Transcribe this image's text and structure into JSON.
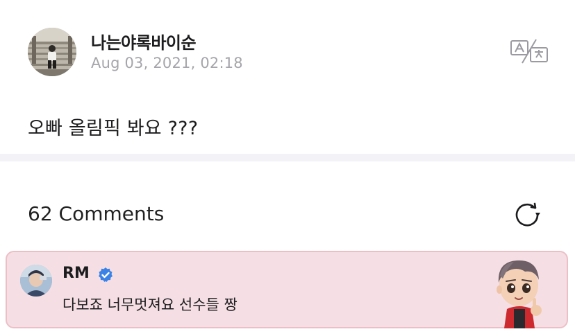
{
  "post": {
    "author": "나는야록바이순",
    "date": "Aug 03, 2021, 02:18",
    "body": "오빠 올림픽 봐요 ???"
  },
  "icons": {
    "translate": "translate-icon",
    "refresh": "refresh-icon",
    "verified": "verified-badge-icon"
  },
  "comments": {
    "count_label": "62 Comments",
    "items": [
      {
        "author": "RM",
        "verified": true,
        "text": "다보죠 너무멋져요 선수들 짱",
        "highlight_color": "#f5dfe4"
      }
    ]
  },
  "colors": {
    "date_gray": "#a5a5aa",
    "divider": "#f2f2f7",
    "verified_blue": "#3b82e6",
    "comment_highlight_border": "#ecbfc7"
  }
}
